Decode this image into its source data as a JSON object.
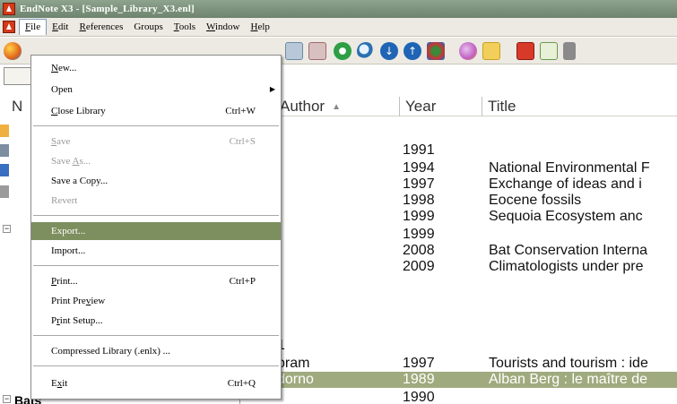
{
  "window": {
    "title": "EndNote X3 - [Sample_Library_X3.enl]"
  },
  "menubar": {
    "items": [
      {
        "acc": "F",
        "rest": "ile"
      },
      {
        "acc": "E",
        "rest": "dit"
      },
      {
        "acc": "R",
        "rest": "eferences"
      },
      {
        "acc": "",
        "rest": "Groups"
      },
      {
        "acc": "T",
        "rest": "ools"
      },
      {
        "acc": "W",
        "rest": "indow"
      },
      {
        "acc": "H",
        "rest": "elp"
      }
    ]
  },
  "file_menu": {
    "items": [
      {
        "pre": "",
        "acc": "N",
        "post": "ew...",
        "shortcut": "",
        "disabled": false
      },
      {
        "pre": "Open",
        "acc": "",
        "post": "",
        "shortcut": "",
        "disabled": false,
        "submenu": true
      },
      {
        "pre": "",
        "acc": "C",
        "post": "lose Library",
        "shortcut": "Ctrl+W",
        "disabled": false
      },
      {
        "pre": "",
        "acc": "S",
        "post": "ave",
        "shortcut": "Ctrl+S",
        "disabled": true
      },
      {
        "pre": "Save ",
        "acc": "A",
        "post": "s...",
        "shortcut": "",
        "disabled": true
      },
      {
        "pre": "Save a Copy...",
        "acc": "",
        "post": "",
        "shortcut": "",
        "disabled": false
      },
      {
        "pre": "Revert",
        "acc": "",
        "post": "",
        "shortcut": "",
        "disabled": true
      },
      {
        "pre": "Export...",
        "acc": "",
        "post": "",
        "shortcut": "",
        "disabled": false,
        "highlighted": true
      },
      {
        "pre": "Import...",
        "acc": "",
        "post": "",
        "shortcut": "",
        "disabled": false
      },
      {
        "pre": "",
        "acc": "P",
        "post": "rint...",
        "shortcut": "Ctrl+P",
        "disabled": false
      },
      {
        "pre": "Print Pre",
        "acc": "v",
        "post": "iew",
        "shortcut": "",
        "disabled": false
      },
      {
        "pre": "P",
        "acc": "r",
        "post": "int Setup...",
        "shortcut": "",
        "disabled": false
      },
      {
        "pre": "Compressed Library (.enlx) ...",
        "acc": "",
        "post": "",
        "shortcut": "",
        "disabled": false
      },
      {
        "pre": "E",
        "acc": "x",
        "post": "it",
        "shortcut": "Ctrl+Q",
        "disabled": false
      }
    ]
  },
  "columns": {
    "author": "Author",
    "year": "Year",
    "title": "Title",
    "first": "N"
  },
  "references": [
    {
      "author": "",
      "year": "1991",
      "title": ""
    },
    {
      "author": "",
      "year": "1994",
      "title": "National Environmental F"
    },
    {
      "author": "",
      "year": "1997",
      "title": "Exchange of ideas and i"
    },
    {
      "author": "",
      "year": "1998",
      "title": "Eocene fossils"
    },
    {
      "author": "",
      "year": "1999",
      "title": "Sequoia Ecosystem anc"
    },
    {
      "author": "",
      "year": "1999",
      "title": ""
    },
    {
      "author": "",
      "year": "2008",
      "title": "Bat Conservation Interna"
    },
    {
      "author": "",
      "year": "2009",
      "title": "Climatologists under pre"
    },
    {
      "author": "",
      "year": "",
      "title": ""
    },
    {
      "author": "1",
      "year": "",
      "title": ""
    },
    {
      "author": "bram",
      "year": "1997",
      "title": "Tourists and tourism : ide"
    },
    {
      "author": "dorno",
      "year": "1989",
      "title": "Alban Berg : le maître de",
      "selected": true
    },
    {
      "author": "",
      "year": "1990",
      "title": ""
    }
  ],
  "left_pane": {
    "group_label": "Bats"
  },
  "colors": {
    "selection": "#9fab7e",
    "menu_highlight": "#7d8f5e",
    "titlebar": "#7d937d"
  }
}
